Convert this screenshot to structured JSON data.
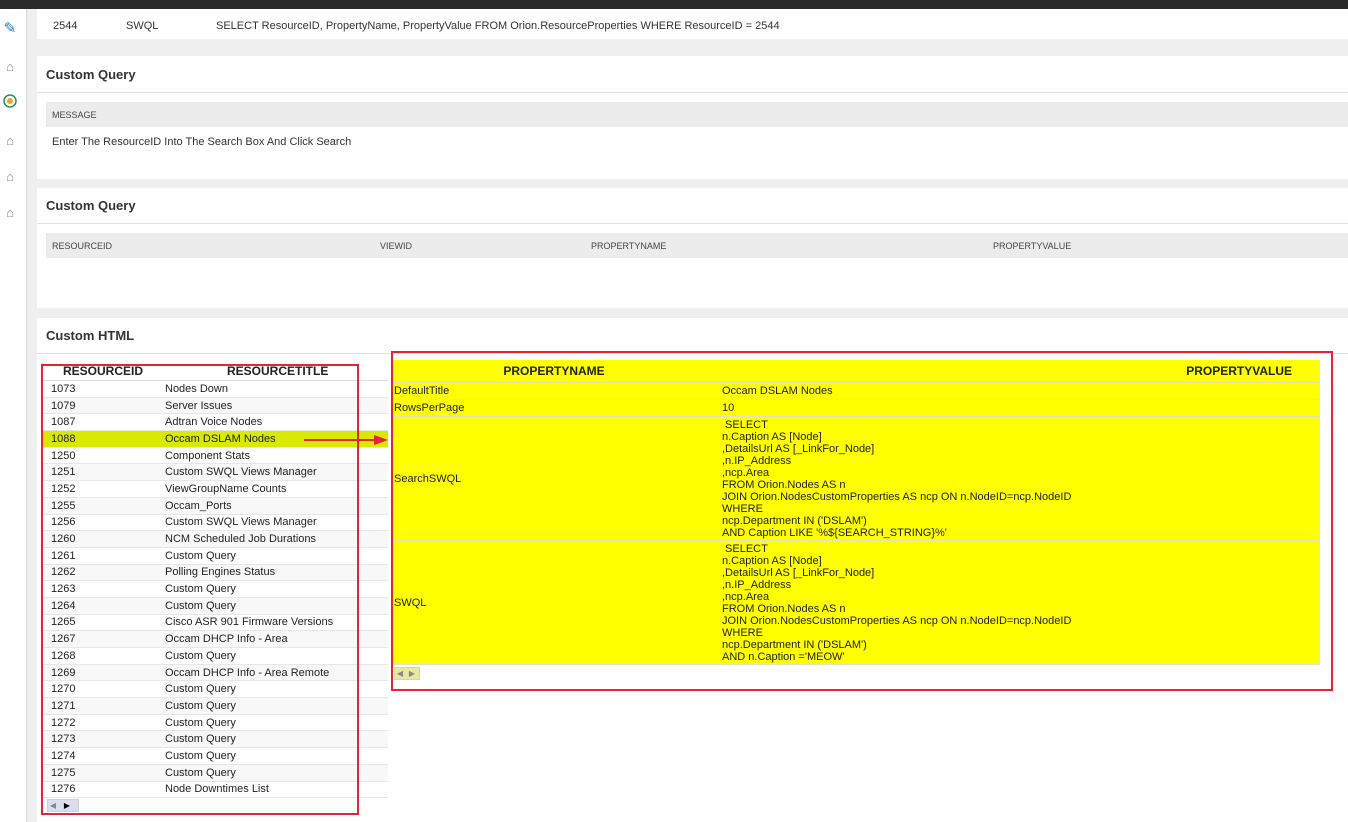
{
  "top_row": {
    "id": "2544",
    "type": "SWQL",
    "query": "SELECT ResourceID, PropertyName, PropertyValue FROM Orion.ResourceProperties WHERE ResourceID = 2544"
  },
  "panel1": {
    "title": "Custom Query",
    "header": "MESSAGE",
    "message": "Enter The ResourceID Into The Search Box And Click Search"
  },
  "panel2": {
    "title": "Custom Query",
    "columns": [
      "RESOURCEID",
      "VIEWID",
      "PROPERTYNAME",
      "PROPERTYVALUE"
    ]
  },
  "panel3": {
    "title": "Custom HTML"
  },
  "left_table": {
    "columns": [
      "RESOURCEID",
      "RESOURCETITLE"
    ],
    "rows": [
      [
        "1073",
        "Nodes Down"
      ],
      [
        "1079",
        "Server Issues"
      ],
      [
        "1087",
        "Adtran Voice Nodes"
      ],
      [
        "1088",
        "Occam DSLAM Nodes"
      ],
      [
        "1250",
        "Component Stats"
      ],
      [
        "1251",
        "Custom SWQL Views Manager"
      ],
      [
        "1252",
        "ViewGroupName Counts"
      ],
      [
        "1255",
        "Occam_Ports"
      ],
      [
        "1256",
        "Custom SWQL Views Manager"
      ],
      [
        "1260",
        "NCM Scheduled Job Durations"
      ],
      [
        "1261",
        "Custom Query"
      ],
      [
        "1262",
        "Polling Engines Status"
      ],
      [
        "1263",
        "Custom Query"
      ],
      [
        "1264",
        "Custom Query"
      ],
      [
        "1265",
        "Cisco ASR 901 Firmware Versions"
      ],
      [
        "1267",
        "Occam DHCP Info - Area"
      ],
      [
        "1268",
        "Custom Query"
      ],
      [
        "1269",
        "Occam DHCP Info - Area Remote"
      ],
      [
        "1270",
        "Custom Query"
      ],
      [
        "1271",
        "Custom Query"
      ],
      [
        "1272",
        "Custom Query"
      ],
      [
        "1273",
        "Custom Query"
      ],
      [
        "1274",
        "Custom Query"
      ],
      [
        "1275",
        "Custom Query"
      ],
      [
        "1276",
        "Node Downtimes List"
      ]
    ],
    "selected": "1088"
  },
  "right_table": {
    "columns": [
      "PROPERTYNAME",
      "PROPERTYVALUE"
    ],
    "rows": [
      {
        "name": "DefaultTitle",
        "value": "Occam DSLAM Nodes"
      },
      {
        "name": "RowsPerPage",
        "value": "10"
      },
      {
        "name": "SearchSWQL",
        "value": " SELECT\nn.Caption AS [Node]\n,DetailsUrl AS [_LinkFor_Node]\n,n.IP_Address\n,ncp.Area\nFROM Orion.Nodes AS n\nJOIN Orion.NodesCustomProperties AS ncp ON n.NodeID=ncp.NodeID\nWHERE\nncp.Department IN ('DSLAM')\nAND Caption LIKE '%${SEARCH_STRING}%'"
      },
      {
        "name": "SWQL",
        "value": " SELECT\nn.Caption AS [Node]\n,DetailsUrl AS [_LinkFor_Node]\n,n.IP_Address\n,ncp.Area\nFROM Orion.Nodes AS n\nJOIN Orion.NodesCustomProperties AS ncp ON n.NodeID=ncp.NodeID\nWHERE\nncp.Department IN ('DSLAM')\nAND n.Caption ='MEOW'"
      }
    ]
  },
  "colors": {
    "highlight": "#ffff00",
    "selected_row": "#d9ea00",
    "annotation": "#e32636"
  },
  "icons": [
    "pencil-icon",
    "home-icon",
    "gauge-icon",
    "home-icon",
    "home-icon",
    "home-icon"
  ]
}
